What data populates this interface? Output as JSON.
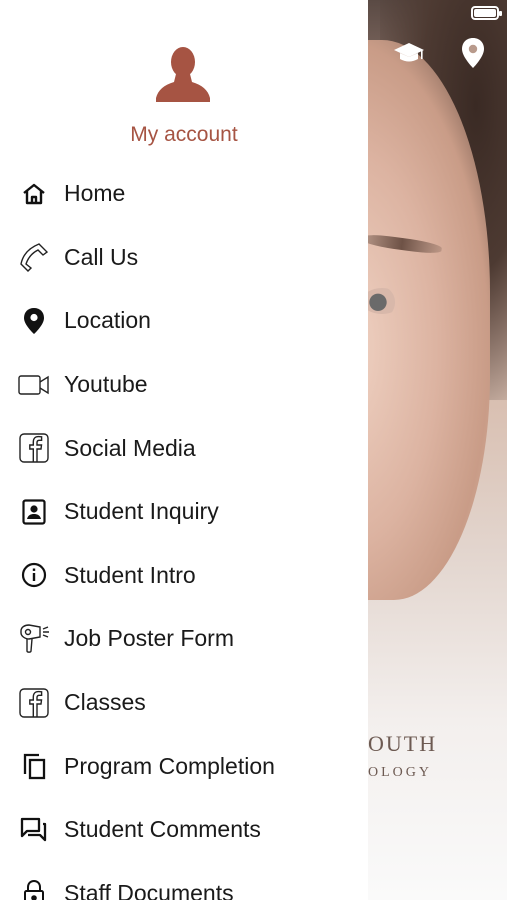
{
  "account": {
    "label": "My account",
    "accent_color": "#a65443"
  },
  "background": {
    "brand_line1": "OUTH",
    "brand_line2": "OLOGY"
  },
  "top_icons": [
    "graduation-cap-icon",
    "map-pin-icon"
  ],
  "menu": {
    "items": [
      {
        "label": "Home",
        "icon": "home-icon"
      },
      {
        "label": "Call Us",
        "icon": "phone-icon"
      },
      {
        "label": "Location",
        "icon": "map-pin-icon"
      },
      {
        "label": "Youtube",
        "icon": "video-camera-icon"
      },
      {
        "label": "Social Media",
        "icon": "facebook-icon"
      },
      {
        "label": "Student Inquiry",
        "icon": "contact-card-icon"
      },
      {
        "label": "Student Intro",
        "icon": "info-icon"
      },
      {
        "label": "Job Poster Form",
        "icon": "hair-dryer-icon"
      },
      {
        "label": "Classes",
        "icon": "facebook-icon"
      },
      {
        "label": "Program Completion",
        "icon": "copy-icon"
      },
      {
        "label": "Student Comments",
        "icon": "chat-bubbles-icon"
      },
      {
        "label": "Staff Documents",
        "icon": "lock-icon"
      }
    ]
  }
}
